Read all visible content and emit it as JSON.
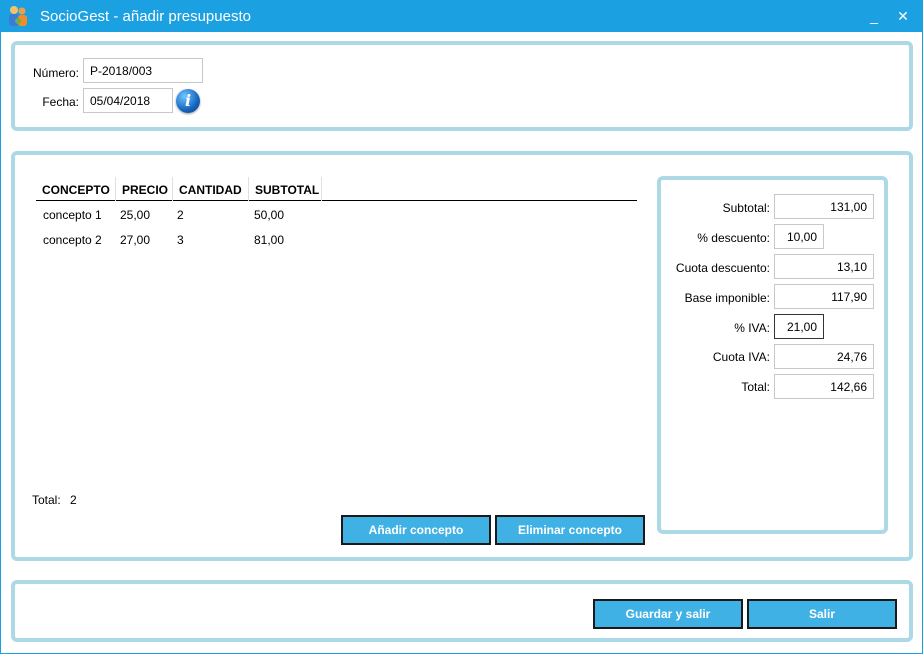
{
  "window": {
    "title": "SocioGest - añadir presupuesto",
    "minimize_glyph": "_",
    "close_glyph": "✕"
  },
  "header": {
    "numero_label": "Número:",
    "numero_value": "P-2018/003",
    "fecha_label": "Fecha:",
    "fecha_value": "05/04/2018",
    "info_icon": "info-icon",
    "info_glyph": "i"
  },
  "table": {
    "columns": [
      "CONCEPTO",
      "PRECIO",
      "CANTIDAD",
      "SUBTOTAL"
    ],
    "rows": [
      [
        "concepto 1",
        "25,00",
        "2",
        "50,00"
      ],
      [
        "concepto 2",
        "27,00",
        "3",
        "81,00"
      ]
    ],
    "total_label": "Total:",
    "total_value": "2"
  },
  "actions": {
    "add_label": "Añadir concepto",
    "remove_label": "Eliminar concepto",
    "save_label": "Guardar y salir",
    "exit_label": "Salir"
  },
  "summary": {
    "subtotal_label": "Subtotal:",
    "subtotal_value": "131,00",
    "descuento_pct_label": "% descuento:",
    "descuento_pct_value": "10,00",
    "cuota_descuento_label": "Cuota descuento:",
    "cuota_descuento_value": "13,10",
    "base_label": "Base imponible:",
    "base_value": "117,90",
    "iva_pct_label": "% IVA:",
    "iva_pct_value": "21,00",
    "cuota_iva_label": "Cuota IVA:",
    "cuota_iva_value": "24,76",
    "total_label": "Total:",
    "total_value": "142,66"
  },
  "colors": {
    "titlebar": "#1ba1e2",
    "panel_border": "#add8e6",
    "button": "#3fb1e5"
  }
}
